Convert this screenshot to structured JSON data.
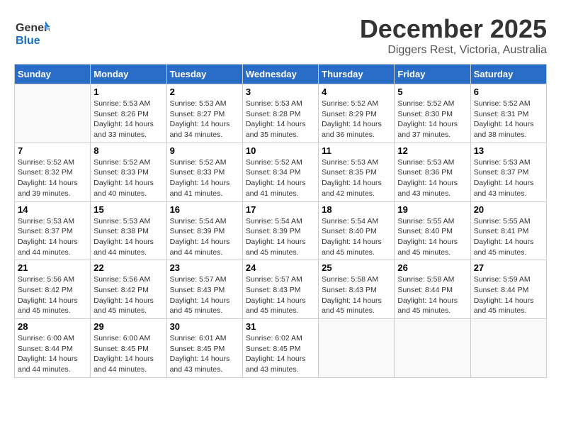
{
  "header": {
    "logo_line1": "General",
    "logo_line2": "Blue",
    "month": "December 2025",
    "location": "Diggers Rest, Victoria, Australia"
  },
  "weekdays": [
    "Sunday",
    "Monday",
    "Tuesday",
    "Wednesday",
    "Thursday",
    "Friday",
    "Saturday"
  ],
  "weeks": [
    [
      {
        "day": "",
        "info": ""
      },
      {
        "day": "1",
        "info": "Sunrise: 5:53 AM\nSunset: 8:26 PM\nDaylight: 14 hours\nand 33 minutes."
      },
      {
        "day": "2",
        "info": "Sunrise: 5:53 AM\nSunset: 8:27 PM\nDaylight: 14 hours\nand 34 minutes."
      },
      {
        "day": "3",
        "info": "Sunrise: 5:53 AM\nSunset: 8:28 PM\nDaylight: 14 hours\nand 35 minutes."
      },
      {
        "day": "4",
        "info": "Sunrise: 5:52 AM\nSunset: 8:29 PM\nDaylight: 14 hours\nand 36 minutes."
      },
      {
        "day": "5",
        "info": "Sunrise: 5:52 AM\nSunset: 8:30 PM\nDaylight: 14 hours\nand 37 minutes."
      },
      {
        "day": "6",
        "info": "Sunrise: 5:52 AM\nSunset: 8:31 PM\nDaylight: 14 hours\nand 38 minutes."
      }
    ],
    [
      {
        "day": "7",
        "info": "Sunrise: 5:52 AM\nSunset: 8:32 PM\nDaylight: 14 hours\nand 39 minutes."
      },
      {
        "day": "8",
        "info": "Sunrise: 5:52 AM\nSunset: 8:33 PM\nDaylight: 14 hours\nand 40 minutes."
      },
      {
        "day": "9",
        "info": "Sunrise: 5:52 AM\nSunset: 8:33 PM\nDaylight: 14 hours\nand 41 minutes."
      },
      {
        "day": "10",
        "info": "Sunrise: 5:52 AM\nSunset: 8:34 PM\nDaylight: 14 hours\nand 41 minutes."
      },
      {
        "day": "11",
        "info": "Sunrise: 5:53 AM\nSunset: 8:35 PM\nDaylight: 14 hours\nand 42 minutes."
      },
      {
        "day": "12",
        "info": "Sunrise: 5:53 AM\nSunset: 8:36 PM\nDaylight: 14 hours\nand 43 minutes."
      },
      {
        "day": "13",
        "info": "Sunrise: 5:53 AM\nSunset: 8:37 PM\nDaylight: 14 hours\nand 43 minutes."
      }
    ],
    [
      {
        "day": "14",
        "info": "Sunrise: 5:53 AM\nSunset: 8:37 PM\nDaylight: 14 hours\nand 44 minutes."
      },
      {
        "day": "15",
        "info": "Sunrise: 5:53 AM\nSunset: 8:38 PM\nDaylight: 14 hours\nand 44 minutes."
      },
      {
        "day": "16",
        "info": "Sunrise: 5:54 AM\nSunset: 8:39 PM\nDaylight: 14 hours\nand 44 minutes."
      },
      {
        "day": "17",
        "info": "Sunrise: 5:54 AM\nSunset: 8:39 PM\nDaylight: 14 hours\nand 45 minutes."
      },
      {
        "day": "18",
        "info": "Sunrise: 5:54 AM\nSunset: 8:40 PM\nDaylight: 14 hours\nand 45 minutes."
      },
      {
        "day": "19",
        "info": "Sunrise: 5:55 AM\nSunset: 8:40 PM\nDaylight: 14 hours\nand 45 minutes."
      },
      {
        "day": "20",
        "info": "Sunrise: 5:55 AM\nSunset: 8:41 PM\nDaylight: 14 hours\nand 45 minutes."
      }
    ],
    [
      {
        "day": "21",
        "info": "Sunrise: 5:56 AM\nSunset: 8:42 PM\nDaylight: 14 hours\nand 45 minutes."
      },
      {
        "day": "22",
        "info": "Sunrise: 5:56 AM\nSunset: 8:42 PM\nDaylight: 14 hours\nand 45 minutes."
      },
      {
        "day": "23",
        "info": "Sunrise: 5:57 AM\nSunset: 8:43 PM\nDaylight: 14 hours\nand 45 minutes."
      },
      {
        "day": "24",
        "info": "Sunrise: 5:57 AM\nSunset: 8:43 PM\nDaylight: 14 hours\nand 45 minutes."
      },
      {
        "day": "25",
        "info": "Sunrise: 5:58 AM\nSunset: 8:43 PM\nDaylight: 14 hours\nand 45 minutes."
      },
      {
        "day": "26",
        "info": "Sunrise: 5:58 AM\nSunset: 8:44 PM\nDaylight: 14 hours\nand 45 minutes."
      },
      {
        "day": "27",
        "info": "Sunrise: 5:59 AM\nSunset: 8:44 PM\nDaylight: 14 hours\nand 45 minutes."
      }
    ],
    [
      {
        "day": "28",
        "info": "Sunrise: 6:00 AM\nSunset: 8:44 PM\nDaylight: 14 hours\nand 44 minutes."
      },
      {
        "day": "29",
        "info": "Sunrise: 6:00 AM\nSunset: 8:45 PM\nDaylight: 14 hours\nand 44 minutes."
      },
      {
        "day": "30",
        "info": "Sunrise: 6:01 AM\nSunset: 8:45 PM\nDaylight: 14 hours\nand 43 minutes."
      },
      {
        "day": "31",
        "info": "Sunrise: 6:02 AM\nSunset: 8:45 PM\nDaylight: 14 hours\nand 43 minutes."
      },
      {
        "day": "",
        "info": ""
      },
      {
        "day": "",
        "info": ""
      },
      {
        "day": "",
        "info": ""
      }
    ]
  ]
}
